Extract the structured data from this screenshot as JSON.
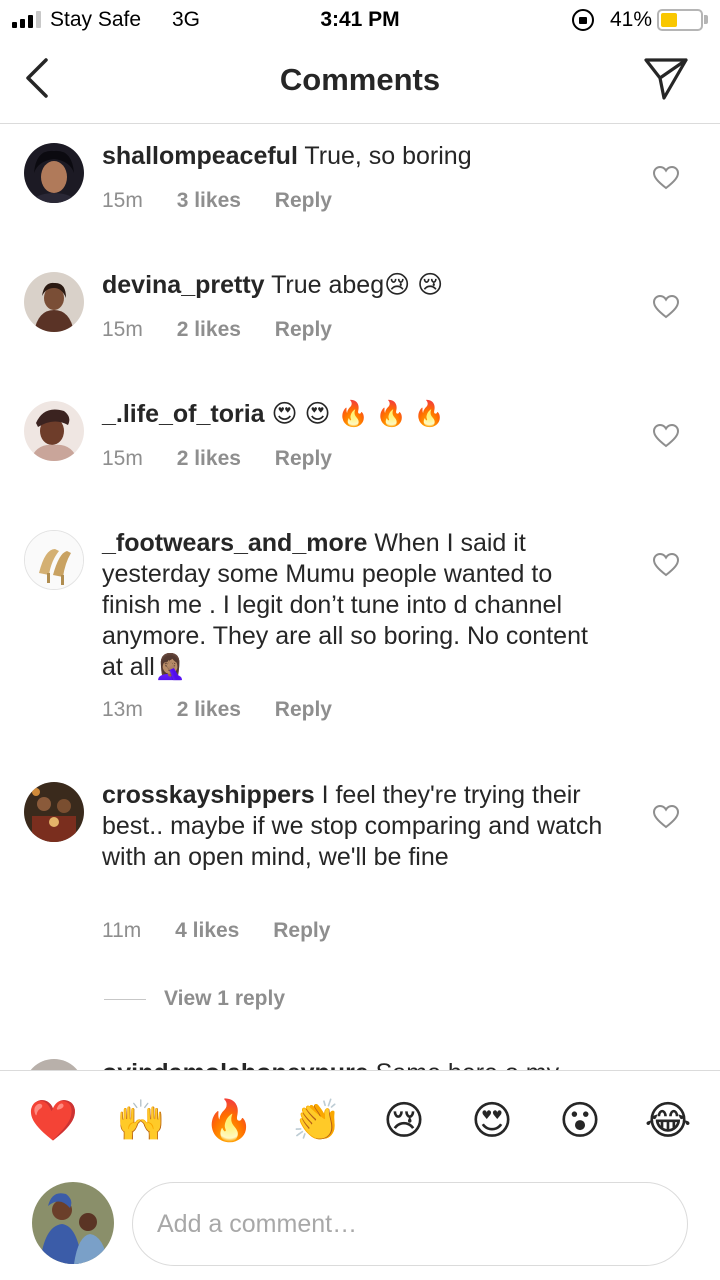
{
  "status_bar": {
    "carrier": "Stay Safe",
    "network": "3G",
    "time": "3:41 PM",
    "battery_percent_label": "41%",
    "battery_level": 0.41,
    "battery_color": "#f9c700"
  },
  "header": {
    "title": "Comments",
    "back_icon": "chevron-left-icon",
    "send_icon": "paper-plane-icon"
  },
  "comments": [
    {
      "username": "shallompeaceful",
      "text": "True, so boring",
      "time": "15m",
      "likes": "3 likes",
      "reply_label": "Reply"
    },
    {
      "username": "devina_pretty",
      "text": "True abeg😢 😢",
      "time": "15m",
      "likes": "2 likes",
      "reply_label": "Reply"
    },
    {
      "username": "_.life_of_toria",
      "text": "😍 😍 🔥 🔥 🔥",
      "time": "15m",
      "likes": "2 likes",
      "reply_label": "Reply"
    },
    {
      "username": "_footwears_and_more",
      "text": "When I said it yesterday some Mumu people wanted to finish me . I legit don’t tune into d channel anymore. They are all so boring. No content at all🤦🏽‍♀️",
      "time": "13m",
      "likes": "2 likes",
      "reply_label": "Reply"
    },
    {
      "username": "crosskayshippers",
      "text": "I feel they're trying their best.. maybe if we stop comparing and watch with an open mind, we'll be fine",
      "time": "11m",
      "likes": "4 likes",
      "reply_label": "Reply"
    }
  ],
  "view_replies_label": "View 1 reply",
  "partial_comment": {
    "username": "oyindamolahoneypure",
    "text": "Same here o my"
  },
  "emoji_bar": [
    "❤️",
    "🙌",
    "🔥",
    "👏",
    "😢",
    "😍",
    "😮",
    "😂"
  ],
  "composer": {
    "placeholder": "Add a comment…"
  },
  "colors": {
    "text": "#262626",
    "secondary": "#8e8e8e",
    "divider": "#dbdbdb"
  }
}
